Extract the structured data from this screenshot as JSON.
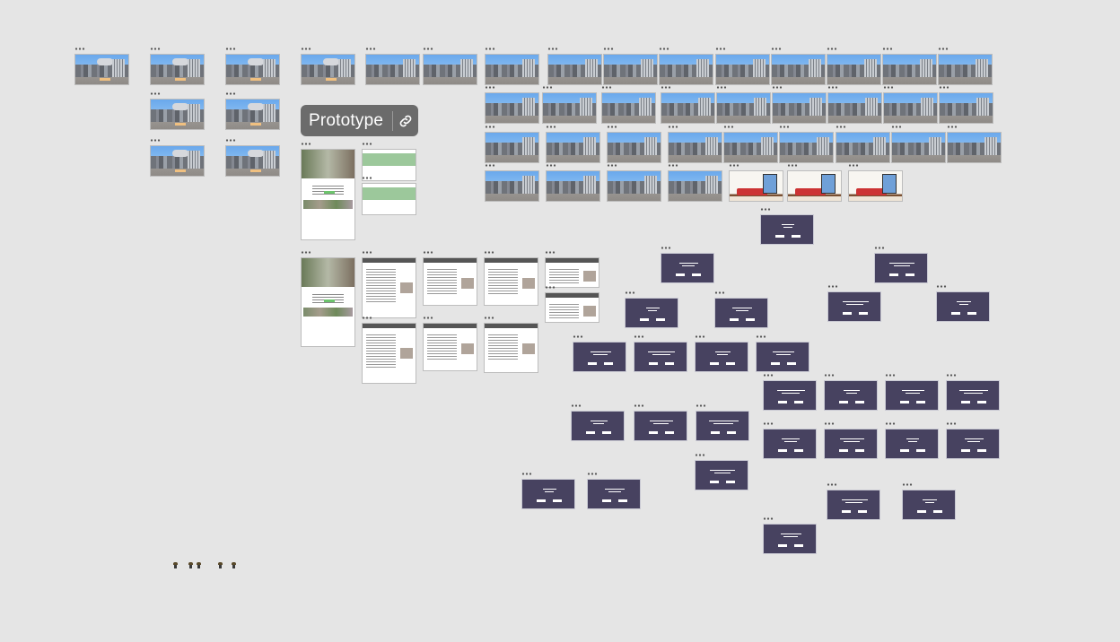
{
  "prototype_chip": {
    "label": "Prototype",
    "icon": "link-icon"
  },
  "colors": {
    "canvas": "#e5e5e5",
    "dark_frame": "#474260",
    "chip": "#6b6b6b",
    "sky": "#6aa8ec"
  },
  "frame_groups": {
    "title_screens": 8,
    "city_scenes": 36,
    "room_scenes": 3,
    "web_pages": 4,
    "article_pages": 9,
    "dialog_frames": 38
  }
}
